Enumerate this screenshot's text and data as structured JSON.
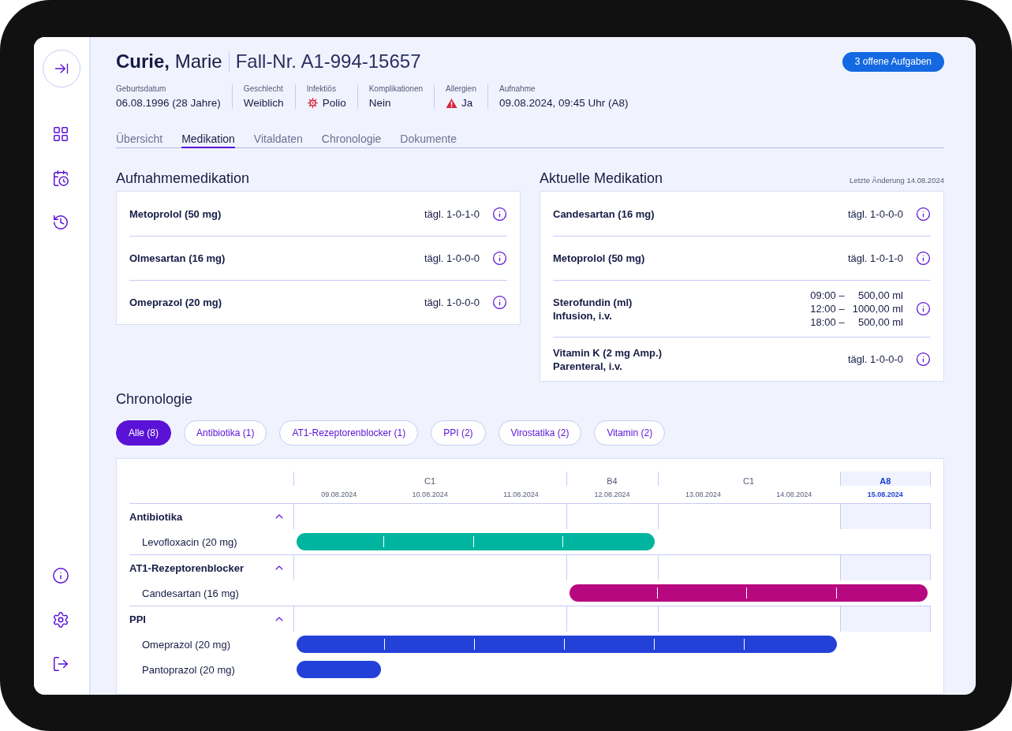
{
  "header": {
    "patient_name": "**Curie,** Marie",
    "case_number": "Fall-Nr. A1-994-15657",
    "tasks_button": "3 offene Aufgaben"
  },
  "facts": [
    {
      "label": "Geburtsdatum",
      "value": "06.08.1996 (28 Jahre)",
      "kind": "plain"
    },
    {
      "label": "Geschlecht",
      "value": "Weiblich",
      "kind": "plain"
    },
    {
      "label": "Infektiös",
      "value": "Polio",
      "kind": "infection"
    },
    {
      "label": "Komplikationen",
      "value": "Nein",
      "kind": "plain"
    },
    {
      "label": "Allergien",
      "value": "Ja",
      "kind": "warning"
    },
    {
      "label": "Aufnahme",
      "value": "09.08.2024, 09:45 Uhr (A8)",
      "kind": "plain"
    }
  ],
  "tabs": [
    {
      "label": "Übersicht",
      "selected": false
    },
    {
      "label": "Medikation",
      "selected": true
    },
    {
      "label": "Vitaldaten",
      "selected": false
    },
    {
      "label": "Chronologie",
      "selected": false
    },
    {
      "label": "Dokumente",
      "selected": false
    }
  ],
  "admission_medication": {
    "title": "Aufnahmemedikation",
    "items": [
      {
        "lines": [
          "Metoprolol (50 mg)"
        ],
        "dose": "tägl. 1-0-1-0"
      },
      {
        "lines": [
          "Olmesartan (16 mg)"
        ],
        "dose": "tägl. 1-0-0-0"
      },
      {
        "lines": [
          "Omeprazol (20 mg)"
        ],
        "dose": "tägl. 1-0-0-0"
      }
    ]
  },
  "current_medication": {
    "title": "Aktuelle Medikation",
    "note": "Letzte Änderung 14.08.2024",
    "items": [
      {
        "lines": [
          "Candesartan (16 mg)"
        ],
        "dose": "tägl. 1-0-0-0"
      },
      {
        "lines": [
          "Metoprolol (50 mg)"
        ],
        "dose": "tägl. 1-0-1-0"
      },
      {
        "lines": [
          "Sterofundin (ml)",
          "Infusion, i.v."
        ],
        "schedule": [
          {
            "time": "09:00 –",
            "amount": "500,00 ml"
          },
          {
            "time": "12:00 –",
            "amount": "1000,00 ml"
          },
          {
            "time": "18:00 –",
            "amount": "500,00 ml"
          }
        ]
      },
      {
        "lines": [
          "Vitamin K (2 mg Amp.)",
          "Parenteral, i.v."
        ],
        "dose": "tägl. 1-0-0-0"
      }
    ]
  },
  "chronology": {
    "title": "Chronologie",
    "filters": [
      {
        "label": "Alle (8)",
        "selected": true
      },
      {
        "label": "Antibiotika (1)",
        "selected": false
      },
      {
        "label": "AT1-Rezeptorenblocker (1)",
        "selected": false
      },
      {
        "label": "PPI (2)",
        "selected": false
      },
      {
        "label": "Virostatika (2)",
        "selected": false
      },
      {
        "label": "Vitamin (2)",
        "selected": false
      }
    ],
    "wards": [
      {
        "label": "C1",
        "dates": [
          "09.08.2024",
          "10.08.2024",
          "11.08.2024"
        ],
        "selected": false
      },
      {
        "label": "B4",
        "dates": [
          "12.08.2024"
        ],
        "selected": false
      },
      {
        "label": "C1",
        "dates": [
          "13.08.2024",
          "14.08.2024"
        ],
        "selected": false
      },
      {
        "label": "A8",
        "dates": [
          "15.08.2024"
        ],
        "selected": true
      }
    ],
    "groups": [
      {
        "name": "Antibiotika",
        "expanded": true,
        "color": "#00b5a0",
        "items": [
          {
            "name": "Levofloxacin (20 mg)",
            "active": [
              true,
              true,
              true,
              true,
              false,
              false,
              false
            ]
          }
        ]
      },
      {
        "name": "AT1-Rezeptorenblocker",
        "expanded": true,
        "color": "#b8087f",
        "items": [
          {
            "name": "Candesartan (16 mg)",
            "active": [
              false,
              false,
              false,
              true,
              true,
              true,
              true
            ]
          }
        ]
      },
      {
        "name": "PPI",
        "expanded": true,
        "color": "#2341d9",
        "items": [
          {
            "name": "Omeprazol (20 mg)",
            "active": [
              true,
              true,
              true,
              true,
              true,
              true,
              false
            ]
          },
          {
            "name": "Pantoprazol (20 mg)",
            "active": [
              true,
              false,
              false,
              false,
              false,
              false,
              false
            ]
          }
        ]
      }
    ]
  }
}
